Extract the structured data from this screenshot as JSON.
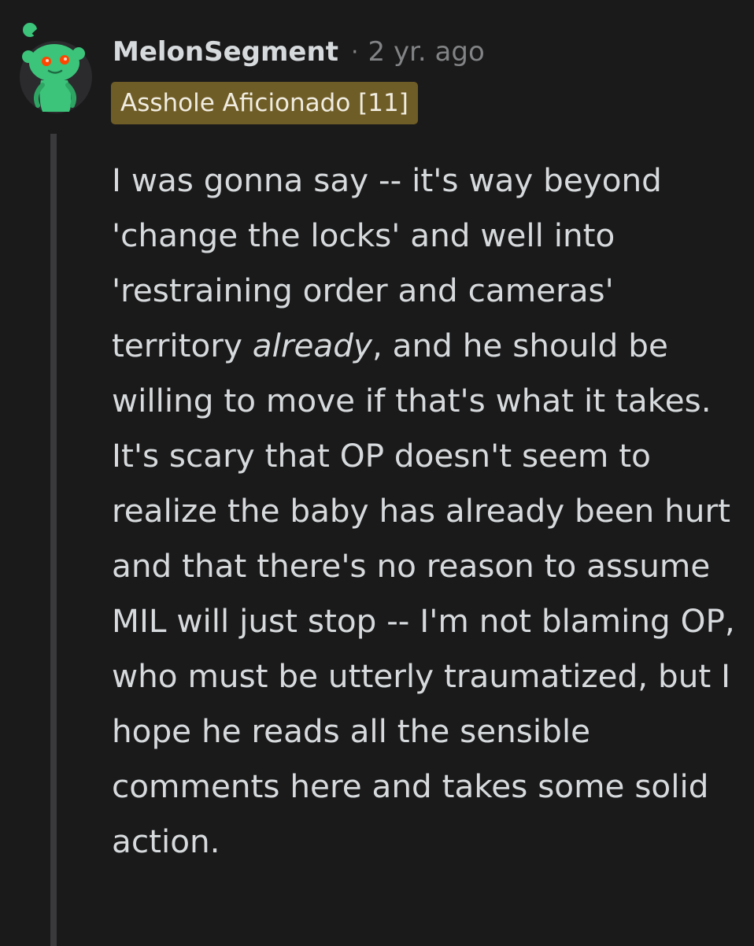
{
  "comment": {
    "username": "MelonSegment",
    "separator": "·",
    "time_ago": "2 yr. ago",
    "flair": "Asshole Aficionado [11]",
    "avatar_icon": "snoo-avatar-icon",
    "body": {
      "part1": "I was gonna say -- it's way beyond 'change the locks' and well into 'restraining order and cameras' territory ",
      "emphasis": "already",
      "part2": ", and he should be willing to move if that's what it takes. It's scary that OP doesn't seem to realize the baby has already been hurt and that there's no reason to assume MIL will just stop -- I'm not blaming OP, who must be utterly traumatized, but I hope he reads all the sensible comments here and takes some solid action."
    }
  },
  "colors": {
    "background": "#1a1a1b",
    "text": "#d7dadc",
    "meta": "#818384",
    "flair_bg": "#6f5d27",
    "avatar_green": "#3bc47a",
    "avatar_eyes": "#ff4500"
  }
}
